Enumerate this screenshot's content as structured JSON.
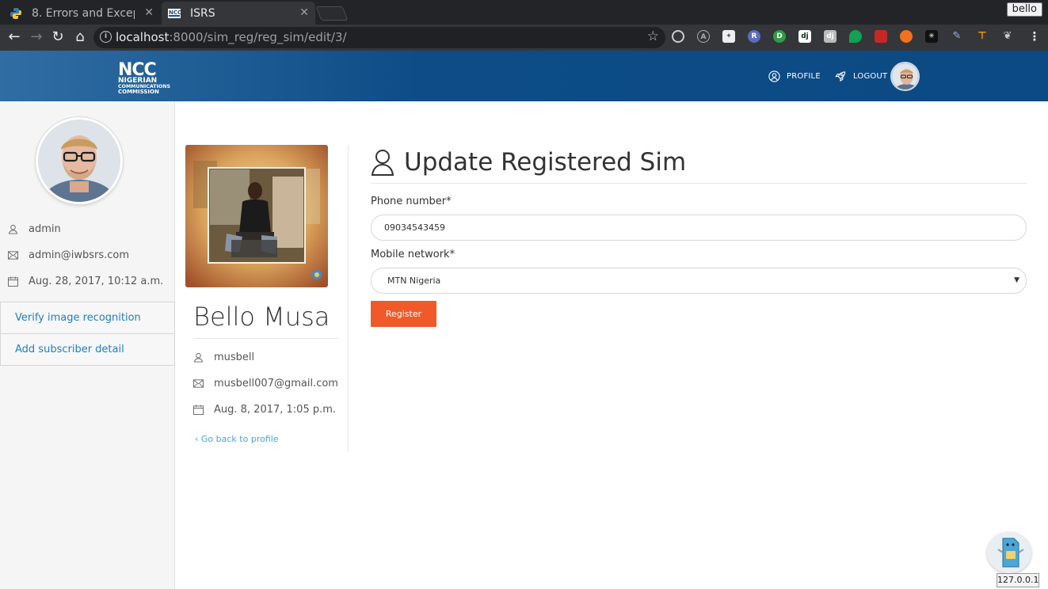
{
  "browser": {
    "tabs": [
      {
        "title": "8. Errors and Excep",
        "active": false
      },
      {
        "title": "ISRS",
        "active": true
      }
    ],
    "user_chip": "bello",
    "url_host": "localhost",
    "url_path": ":8000/sim_reg/reg_sim/edit/3/"
  },
  "header": {
    "logo_text": "NCC",
    "logo_sub": [
      "NIGERIAN",
      "COMMUNICATIONS",
      "COMMISSION"
    ],
    "nav": [
      {
        "label": "PROFILE",
        "icon": "user-circle-icon"
      },
      {
        "label": "LOGOUT",
        "icon": "rocket-icon"
      }
    ]
  },
  "sidebar": {
    "username": "admin",
    "email": "admin@iwbsrs.com",
    "date": "Aug. 28, 2017, 10:12 a.m.",
    "links": [
      "Verify image recognition",
      "Add subscriber detail"
    ]
  },
  "profile": {
    "name": "Bello Musa",
    "username": "musbell",
    "email": "musbell007@gmail.com",
    "date": "Aug. 8, 2017, 1:05 p.m.",
    "back_link": "Go back to profile"
  },
  "form": {
    "title": "Update Registered Sim",
    "phone_label": "Phone number*",
    "phone_value": "09034543459",
    "network_label": "Mobile network*",
    "network_value": "MTN Nigeria",
    "submit_label": "Register"
  },
  "debug": {
    "ip": "127.0.0.1"
  },
  "colors": {
    "header": "#0b4a84",
    "accent_button": "#f05a28",
    "link": "#1e7ec8"
  }
}
